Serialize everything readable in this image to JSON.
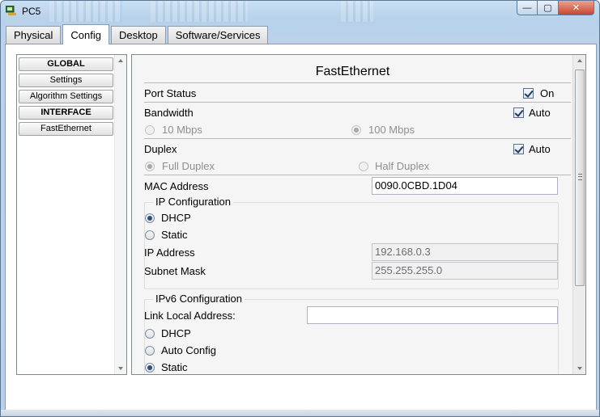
{
  "window": {
    "title": "PC5",
    "controls": {
      "minimize": "—",
      "maximize": "▢",
      "close": "✕"
    }
  },
  "tabs": [
    {
      "label": "Physical"
    },
    {
      "label": "Config",
      "active": true
    },
    {
      "label": "Desktop"
    },
    {
      "label": "Software/Services"
    }
  ],
  "nav": {
    "items": [
      {
        "label": "GLOBAL",
        "type": "header"
      },
      {
        "label": "Settings"
      },
      {
        "label": "Algorithm Settings"
      },
      {
        "label": "INTERFACE",
        "type": "header"
      },
      {
        "label": "FastEthernet"
      }
    ]
  },
  "config": {
    "title": "FastEthernet",
    "port_status": {
      "label": "Port Status",
      "checkbox_label": "On",
      "checked": true
    },
    "bandwidth": {
      "label": "Bandwidth",
      "checkbox_label": "Auto",
      "checked": true,
      "option_10": "10 Mbps",
      "option_100": "100 Mbps",
      "selected": "100 Mbps"
    },
    "duplex": {
      "label": "Duplex",
      "checkbox_label": "Auto",
      "checked": true,
      "option_full": "Full Duplex",
      "option_half": "Half Duplex",
      "selected": "Full Duplex"
    },
    "mac": {
      "label": "MAC Address",
      "value": "0090.0CBD.1D04"
    },
    "ip_config": {
      "legend": "IP Configuration",
      "dhcp": "DHCP",
      "static": "Static",
      "selected": "DHCP",
      "ip_label": "IP Address",
      "ip_value": "192.168.0.3",
      "mask_label": "Subnet Mask",
      "mask_value": "255.255.255.0"
    },
    "ipv6_config": {
      "legend": "IPv6 Configuration",
      "link_local_label": "Link Local Address:",
      "link_local_value": "",
      "dhcp": "DHCP",
      "auto": "Auto Config",
      "static": "Static",
      "selected": "Static"
    }
  },
  "colors": {
    "frame": "#b9d0e8",
    "accent": "#2a4f7a",
    "close": "#c8452e"
  }
}
